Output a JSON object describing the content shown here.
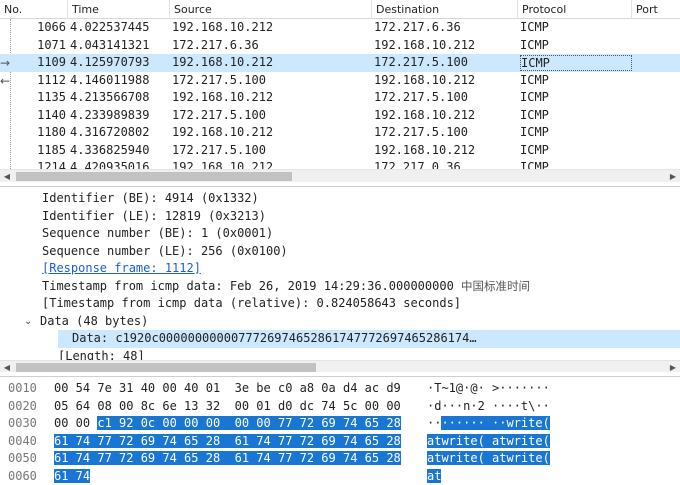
{
  "packet_list": {
    "columns": [
      "No.",
      "Time",
      "Source",
      "Destination",
      "Protocol",
      "Port"
    ],
    "rows": [
      {
        "no": "1066",
        "time": "4.022537445",
        "src": "192.168.10.212",
        "dst": "172.217.6.36",
        "proto": "ICMP"
      },
      {
        "no": "1071",
        "time": "4.043141321",
        "src": "172.217.6.36",
        "dst": "192.168.10.212",
        "proto": "ICMP"
      },
      {
        "no": "1109",
        "time": "4.125970793",
        "src": "192.168.10.212",
        "dst": "172.217.5.100",
        "proto": "ICMP"
      },
      {
        "no": "1112",
        "time": "4.146011988",
        "src": "172.217.5.100",
        "dst": "192.168.10.212",
        "proto": "ICMP"
      },
      {
        "no": "1135",
        "time": "4.213566708",
        "src": "192.168.10.212",
        "dst": "172.217.5.100",
        "proto": "ICMP"
      },
      {
        "no": "1140",
        "time": "4.233989839",
        "src": "172.217.5.100",
        "dst": "192.168.10.212",
        "proto": "ICMP"
      },
      {
        "no": "1180",
        "time": "4.316720802",
        "src": "192.168.10.212",
        "dst": "172.217.5.100",
        "proto": "ICMP"
      },
      {
        "no": "1185",
        "time": "4.336825940",
        "src": "172.217.5.100",
        "dst": "192.168.10.212",
        "proto": "ICMP"
      },
      {
        "no": "1214",
        "time": "4.420935016",
        "src": "192.168.10.212",
        "dst": "172.217.0.36",
        "proto": "ICMP"
      }
    ],
    "request_glyph": "→",
    "response_glyph": "←"
  },
  "details": {
    "identifier_be": "Identifier (BE): 4914 (0x1332)",
    "identifier_le": "Identifier (LE): 12819 (0x3213)",
    "seq_be": "Sequence number (BE): 1 (0x0001)",
    "seq_le": "Sequence number (LE): 256 (0x0100)",
    "response_frame": "[Response frame: 1112]",
    "timestamp": "Timestamp from icmp data: Feb 26, 2019 14:29:36.000000000",
    "timestamp_tz": "中国标准时间",
    "timestamp_rel": "[Timestamp from icmp data (relative): 0.824058643 seconds]",
    "data_node": "Data (48 bytes)",
    "data_value": "Data: c1920c0000000000077726974652861747772697465286174…",
    "length": "[Length: 48]",
    "twisty": "⌄"
  },
  "bytes": {
    "rows": [
      {
        "offset": "0010",
        "hex_pre": "00 54 7e 31 40 00 40 01  3e be c0 a8 0a d4 ac d9",
        "hex_hl": "",
        "ascii_pre": "·T~1@·@· >·······",
        "ascii_hl": ""
      },
      {
        "offset": "0020",
        "hex_pre": "05 64 08 00 8c 6e 13 32  00 01 d0 dc 74 5c 00 00",
        "hex_hl": "",
        "ascii_pre": "·d···n·2 ····t\\··",
        "ascii_hl": ""
      },
      {
        "offset": "0030",
        "hex_pre": "00 00 ",
        "hex_hl": "c1 92 0c 00 00 00  00 00 77 72 69 74 65 28",
        "ascii_pre": "··",
        "ascii_hl": "······ ··write("
      },
      {
        "offset": "0040",
        "hex_pre": "",
        "hex_hl": "61 74 77 72 69 74 65 28  61 74 77 72 69 74 65 28",
        "ascii_pre": "",
        "ascii_hl": "atwrite( atwrite("
      },
      {
        "offset": "0050",
        "hex_pre": "",
        "hex_hl": "61 74 77 72 69 74 65 28  61 74 77 72 69 74 65 28",
        "ascii_pre": "",
        "ascii_hl": "atwrite( atwrite("
      },
      {
        "offset": "0060",
        "hex_pre": "",
        "hex_hl": "61 74",
        "ascii_pre": "",
        "ascii_hl": "at"
      }
    ]
  },
  "scroll": {
    "left_arrow": "◀",
    "right_arrow": "▶",
    "sort_arrow": "^"
  },
  "colors": {
    "selection_row": "#cce8ff",
    "byte_highlight": "#1976d2",
    "link": "#1a5fd0"
  }
}
